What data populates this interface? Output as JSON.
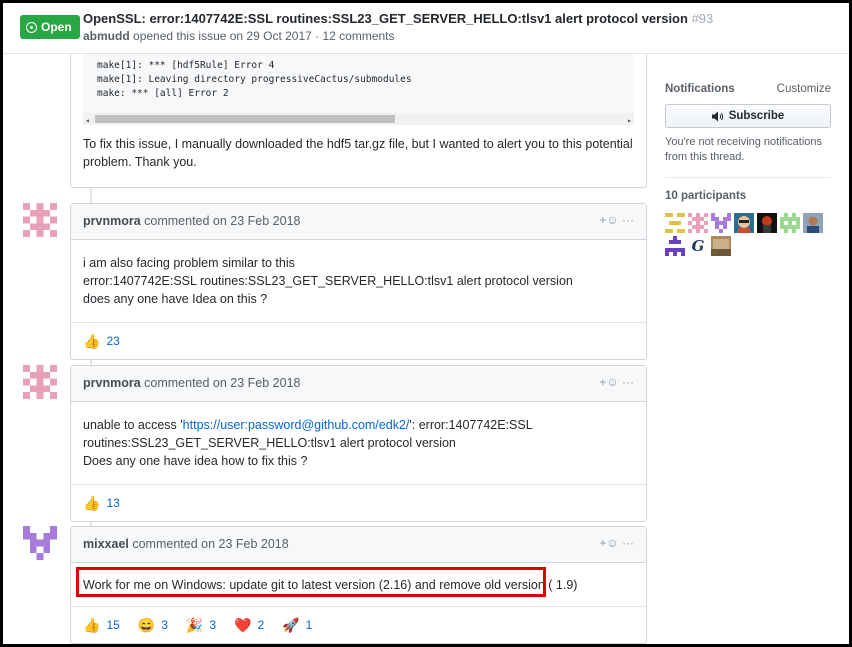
{
  "header": {
    "state": "Open",
    "title": "OpenSSL: error:1407742E:SSL routines:SSL23_GET_SERVER_HELLO:tlsv1 alert protocol version",
    "number": "#93",
    "author": "abmudd",
    "meta": "opened this issue on 29 Oct 2017 · 12 comments"
  },
  "first_comment": {
    "code_lines": [
      "make[1]: *** [hdf5Rule] Error 4",
      "make[1]: Leaving directory progressiveCactus/submodules",
      "make: *** [all] Error 2"
    ],
    "text_line1": "To fix this issue, I manually downloaded the hdf5 tar.gz file, but I wanted to alert you to this potential",
    "text_line2": "problem. Thank you."
  },
  "comments": [
    {
      "author": "prvnmora",
      "meta": "commented on 23 Feb 2018",
      "lines": [
        "i am also facing problem similar to this",
        "error:1407742E:SSL routines:SSL23_GET_SERVER_HELLO:tlsv1 alert protocol version",
        "does any one have Idea on this ?"
      ],
      "reactions": [
        {
          "emoji": "👍",
          "count": "23"
        }
      ]
    },
    {
      "author": "prvnmora",
      "meta": "commented on 23 Feb 2018",
      "line1_prefix": "unable to access '",
      "link": "https://user:password@github.com/edk2/",
      "line1_suffix": "': error:1407742E:SSL",
      "line2": "routines:SSL23_GET_SERVER_HELLO:tlsv1 alert protocol version",
      "line3": "Does any one have idea how to fix this ?",
      "reactions": [
        {
          "emoji": "👍",
          "count": "13"
        }
      ]
    },
    {
      "author": "mixxael",
      "meta": "commented on 23 Feb 2018",
      "text": "Work for me on Windows: update git to latest version (2.16) and remove old version ( 1.9)",
      "reactions": [
        {
          "emoji": "👍",
          "count": "15"
        },
        {
          "emoji": "😄",
          "count": "3"
        },
        {
          "emoji": "🎉",
          "count": "3"
        },
        {
          "emoji": "❤️",
          "count": "2"
        },
        {
          "emoji": "🚀",
          "count": "1"
        }
      ]
    }
  ],
  "actions_glyph": "+☺  ···",
  "sidebar": {
    "notifications_title": "Notifications",
    "customize": "Customize",
    "subscribe_label": "Subscribe",
    "note": "You're not receiving notifications from this thread.",
    "participants_title": "10 participants"
  },
  "colors": {
    "open_green": "#28a745",
    "link_blue": "#0366d6",
    "highlight_red": "#e00000",
    "identicon_pink": "#e8a1b8",
    "identicon_purple": "#a77bd9"
  }
}
